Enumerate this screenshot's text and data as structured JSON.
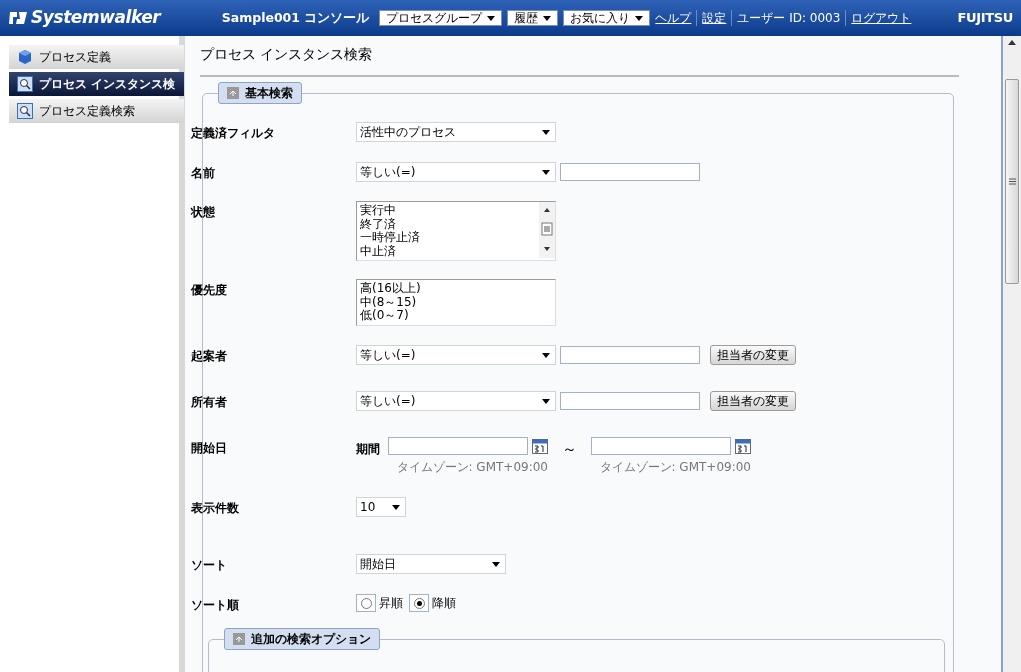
{
  "header": {
    "logo": "Systemwalker",
    "console": "Sample001 コンソール",
    "menus": [
      {
        "label": "プロセスグループ"
      },
      {
        "label": "履歴"
      },
      {
        "label": "お気に入り"
      }
    ],
    "links": [
      {
        "label": "ヘルプ",
        "kind": "link"
      },
      {
        "label": "設定",
        "kind": "link"
      },
      {
        "label": "ユーザー ID: 0003",
        "kind": "text"
      },
      {
        "label": "ログアウト",
        "kind": "link"
      }
    ],
    "brand": "FUJITSU"
  },
  "sidebar": {
    "items": [
      {
        "label": "プロセス定義",
        "kind": "definition",
        "selected": false
      },
      {
        "label": "プロセス インスタンス検",
        "kind": "search",
        "selected": true
      },
      {
        "label": "プロセス定義検索",
        "kind": "search",
        "selected": false
      }
    ]
  },
  "page_title": "プロセス インスタンス検索",
  "basic_search": {
    "legend": "基本検索",
    "fields": [
      {
        "kind": "select",
        "label": "定義済フィルタ",
        "value": "活性中のプロセス"
      },
      {
        "kind": "select_text",
        "label": "名前",
        "value": "等しい(=)"
      },
      {
        "kind": "listbox",
        "label": "状態",
        "options": [
          "実行中",
          "終了済",
          "一時停止済",
          "中止済"
        ],
        "scrollbar": true
      },
      {
        "kind": "listbox",
        "label": "優先度",
        "options": [
          "高(16以上)",
          "中(8～15)",
          "低(0～7)"
        ],
        "scrollbar": false
      },
      {
        "kind": "select_text_button",
        "label": "起案者",
        "value": "等しい(=)",
        "button": "担当者の変更"
      },
      {
        "kind": "select_text_button",
        "label": "所有者",
        "value": "等しい(=)",
        "button": "担当者の変更"
      },
      {
        "kind": "date_range",
        "label": "開始日",
        "prefix": "期間",
        "separator": "～",
        "timezones": [
          "タイムゾーン: GMT+09:00",
          "タイムゾーン: GMT+09:00"
        ]
      },
      {
        "kind": "count_select",
        "label": "表示件数",
        "value": "10"
      },
      {
        "kind": "sort_select",
        "label": "ソート",
        "value": "開始日"
      },
      {
        "kind": "radio",
        "label": "ソート順",
        "options": [
          {
            "label": "昇順",
            "selected": false
          },
          {
            "label": "降順",
            "selected": true
          }
        ]
      }
    ]
  },
  "extra_options": {
    "legend": "追加の検索オプション"
  }
}
